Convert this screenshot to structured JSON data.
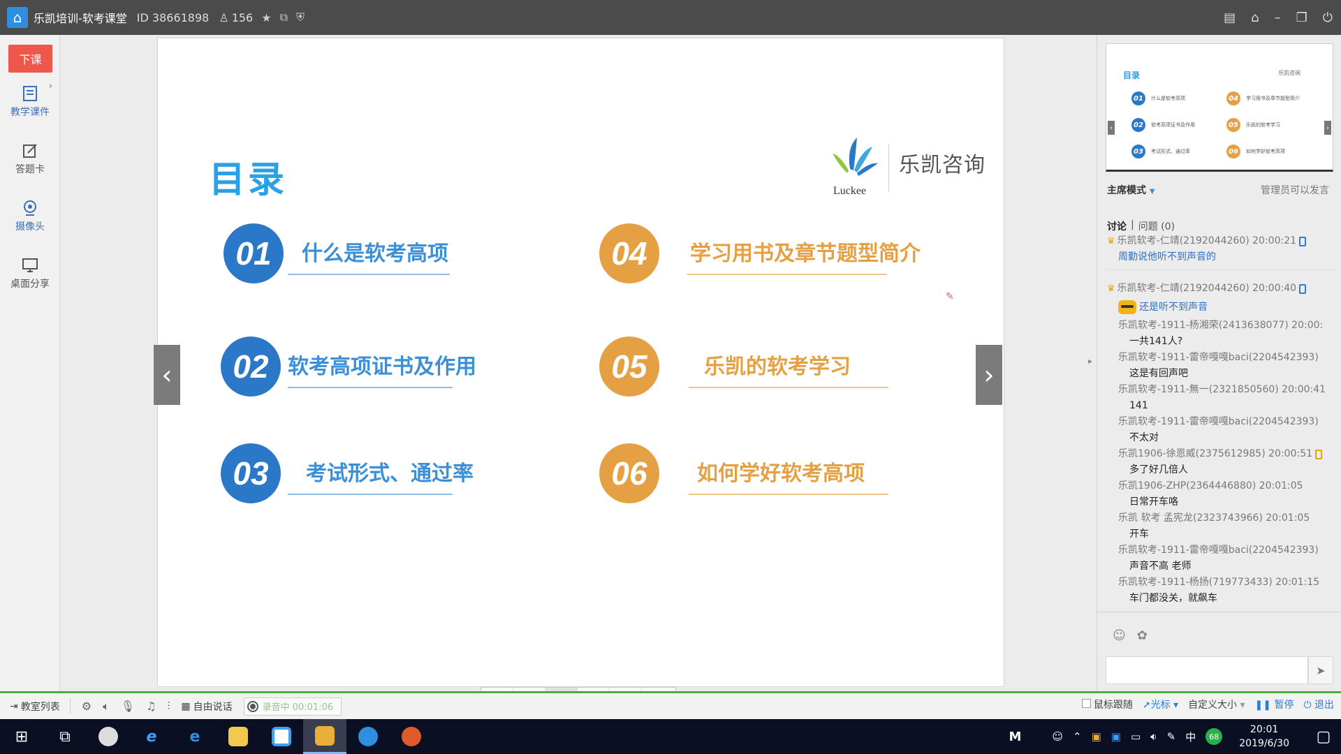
{
  "titlebar": {
    "title": "乐凯培训-软考课堂",
    "room_id": "ID 38661898",
    "user_count": "156"
  },
  "sidebar": {
    "end_class": "下课",
    "items": [
      {
        "label": "教学课件",
        "icon": "courseware-icon"
      },
      {
        "label": "答题卡",
        "icon": "answer-card-icon"
      },
      {
        "label": "摄像头",
        "icon": "camera-icon"
      },
      {
        "label": "桌面分享",
        "icon": "desktop-share-icon"
      }
    ]
  },
  "slide": {
    "title": "目录",
    "logo_text": "乐凯咨询",
    "logo_sub": "Luckee",
    "items": [
      {
        "num": "01",
        "label": "什么是软考高项",
        "color": "#2b78c8"
      },
      {
        "num": "02",
        "label": "软考高项证书及作用",
        "color": "#2b78c8"
      },
      {
        "num": "03",
        "label": "考试形式、通过率",
        "color": "#2b78c8"
      },
      {
        "num": "04",
        "label": "学习用书及章节题型简介",
        "color": "#e5a043"
      },
      {
        "num": "05",
        "label": "乐凯的软考学习",
        "color": "#e5a043"
      },
      {
        "num": "06",
        "label": "如何学好软考高项",
        "color": "#e5a043"
      }
    ]
  },
  "panel": {
    "thumbnail": {
      "title": "目录",
      "logo": "乐凯咨询",
      "items": [
        "什么是软考高项",
        "软考高项证书及作用",
        "考试形式、通过率",
        "学习用书及章节题型简介",
        "乐凯的软考学习",
        "如何学好软考高项"
      ]
    },
    "mode": "主席模式",
    "admin_note": "管理员可以发言",
    "tab_discussion": "讨论",
    "tab_questions": "问题 (0)",
    "messages": [
      {
        "head": "乐凯软考-仁靖(2192044260) 20:00:21",
        "body": "周勤说他听不到声音的",
        "admin": true,
        "phone": true,
        "blue": true
      },
      {
        "head": "乐凯软考-仁靖(2192044260) 20:00:40",
        "body": "还是听不到声音",
        "admin": true,
        "phone": true,
        "blue": true,
        "emoji": true
      },
      {
        "head": "乐凯软考-1911-杨湘荣(2413638077) 20:00:",
        "body": "一共141人?"
      },
      {
        "head": "乐凯软考-1911-雷帝嘎嘎baci(2204542393)",
        "body": "这是有回声吧"
      },
      {
        "head": "乐凯软考-1911-無一(2321850560) 20:00:41",
        "body": "141"
      },
      {
        "head": "乐凯软考-1911-雷帝嘎嘎baci(2204542393)",
        "body": "不太对"
      },
      {
        "head": "乐凯1906-徐恩威(2375612985) 20:00:51",
        "body": "多了好几倍人",
        "phone": true
      },
      {
        "head": "乐凯1906-ZHP(2364446880) 20:01:05",
        "body": "日常开车咯"
      },
      {
        "head": "乐凯 软考 孟宪龙(2323743966) 20:01:05",
        "body": "开车"
      },
      {
        "head": "乐凯软考-1911-雷帝嘎嘎baci(2204542393)",
        "body": "声音不高 老师"
      },
      {
        "head": "乐凯软考-1911-杨扬(719773433) 20:01:15",
        "body": "车门都没关，就飙车"
      }
    ]
  },
  "bottombar": {
    "classroom_list": "教室列表",
    "free_talk": "自由说话",
    "recording": "录音中 00:01:06",
    "follow_mouse": "鼠标跟随",
    "cursor": "光标",
    "custom_size": "自定义大小",
    "pause": "暂停",
    "exit": "退出"
  },
  "taskbar": {
    "time": "20:01",
    "date": "2019/6/30",
    "ime": "中",
    "badge": "68"
  }
}
